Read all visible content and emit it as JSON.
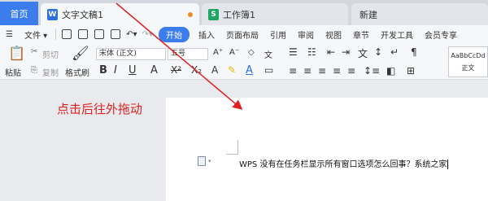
{
  "tabs": {
    "home": "首页",
    "doc": "文字文稿1",
    "sheet": "工作簿1",
    "new": "新建"
  },
  "menu": {
    "file": "文件",
    "items": [
      "开始",
      "插入",
      "页面布局",
      "引用",
      "审阅",
      "视图",
      "章节",
      "开发工具",
      "会员专享"
    ]
  },
  "ribbon": {
    "paste": "粘贴",
    "cut": "剪切",
    "copy": "复制",
    "format_painter": "格式刷",
    "font_name": "宋体 (正文)",
    "font_size": "五号",
    "style_preview": "AaBbCcDd",
    "style_name": "正文"
  },
  "document": {
    "text": "WPS 没有在任务栏显示所有窗口选项怎么回事？系统之家"
  },
  "annotation": {
    "text": "点击后往外拖动"
  },
  "colors": {
    "accent": "#3b7ded",
    "writer_icon": "#2b6fe0",
    "sheet_icon": "#1fa463",
    "annotation": "#e02020",
    "modified_dot": "#e8901c"
  },
  "icons": [
    "writer-doc-icon",
    "spreadsheet-icon",
    "save-icon",
    "print-icon",
    "undo-icon",
    "redo-icon",
    "paste-icon",
    "scissors-icon",
    "copy-icon",
    "brush-icon",
    "bold-icon",
    "italic-icon",
    "underline-icon",
    "paragraph-icon"
  ]
}
